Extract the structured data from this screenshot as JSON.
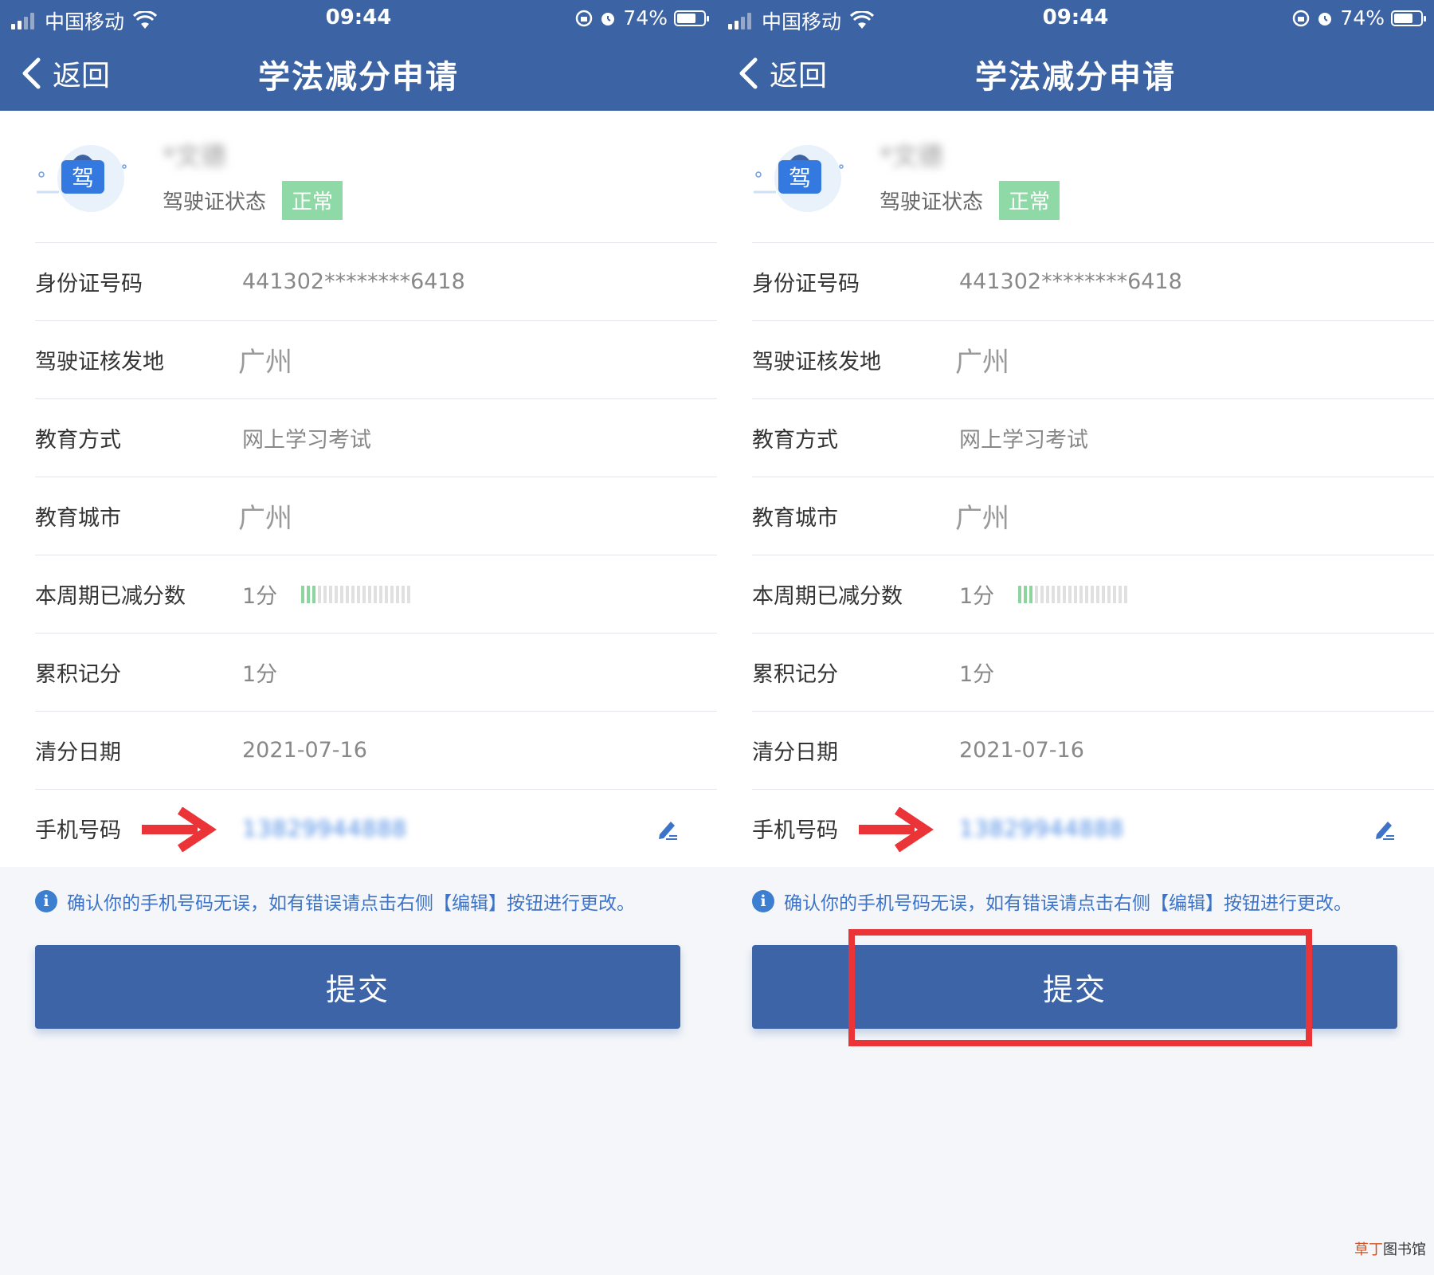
{
  "status_bar": {
    "carrier": "中国移动",
    "time": "09:44",
    "battery": "74%",
    "battery_level": 0.74
  },
  "nav": {
    "back_label": "返回",
    "title": "学法减分申请"
  },
  "profile": {
    "icon_char": "驾",
    "name": "*文德",
    "status_label": "驾驶证状态",
    "status_value": "正常"
  },
  "fields": {
    "id_number": {
      "label": "身份证号码",
      "value": "441302********6418"
    },
    "issue_place": {
      "label": "驾驶证核发地",
      "value": "广州"
    },
    "edu_method": {
      "label": "教育方式",
      "value": "网上学习考试"
    },
    "edu_city": {
      "label": "教育城市",
      "value": "广州"
    },
    "deducted": {
      "label": "本周期已减分数",
      "value": "1分",
      "progress_on": 3,
      "progress_total": 20
    },
    "cumulative": {
      "label": "累积记分",
      "value": "1分"
    },
    "clear_date": {
      "label": "清分日期",
      "value": "2021-07-16"
    },
    "phone": {
      "label": "手机号码",
      "value": "13829944888"
    }
  },
  "notice": "确认你的手机号码无误，如有错误请点击右侧【编辑】按钮进行更改。",
  "submit_label": "提交",
  "watermark": {
    "part_a": "草丁",
    "part_b": "图书馆"
  },
  "colors": {
    "header": "#3c63a3",
    "status_badge": "#8ed9a6",
    "highlight": "#ea3438",
    "arrow": "#ea3438",
    "link_blue": "#3d74c7"
  }
}
